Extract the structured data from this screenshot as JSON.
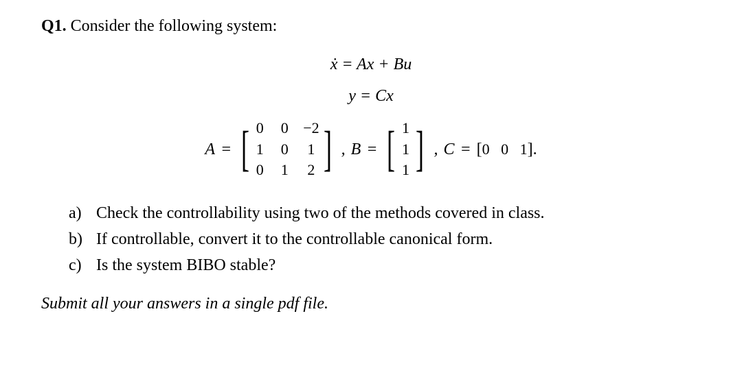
{
  "header": {
    "label": "Q1.",
    "text": "Consider the following system:"
  },
  "equations": {
    "line1": "ẋ = Ax + Bu",
    "line2": "y = Cx"
  },
  "matrices": {
    "A_label": "A",
    "eq": "=",
    "A": {
      "r1c1": "0",
      "r1c2": "0",
      "r1c3": "−2",
      "r2c1": "1",
      "r2c2": "0",
      "r2c3": "1",
      "r3c1": "0",
      "r3c2": "1",
      "r3c3": "2"
    },
    "comma": ",",
    "B_label": "B",
    "B": {
      "r1": "1",
      "r2": "1",
      "r3": "1"
    },
    "C_label": "C",
    "C_prefix": "[",
    "C": {
      "c1": "0",
      "c2": "0",
      "c3": "1"
    },
    "C_suffix": "].",
    "period": "."
  },
  "subquestions": {
    "a": {
      "letter": "a)",
      "text": "Check the controllability using two of the methods covered in class."
    },
    "b": {
      "letter": "b)",
      "text": "If controllable, convert it to the controllable canonical form."
    },
    "c": {
      "letter": "c)",
      "text": "Is the system BIBO stable?"
    }
  },
  "submit": "Submit all your answers in a single pdf file."
}
